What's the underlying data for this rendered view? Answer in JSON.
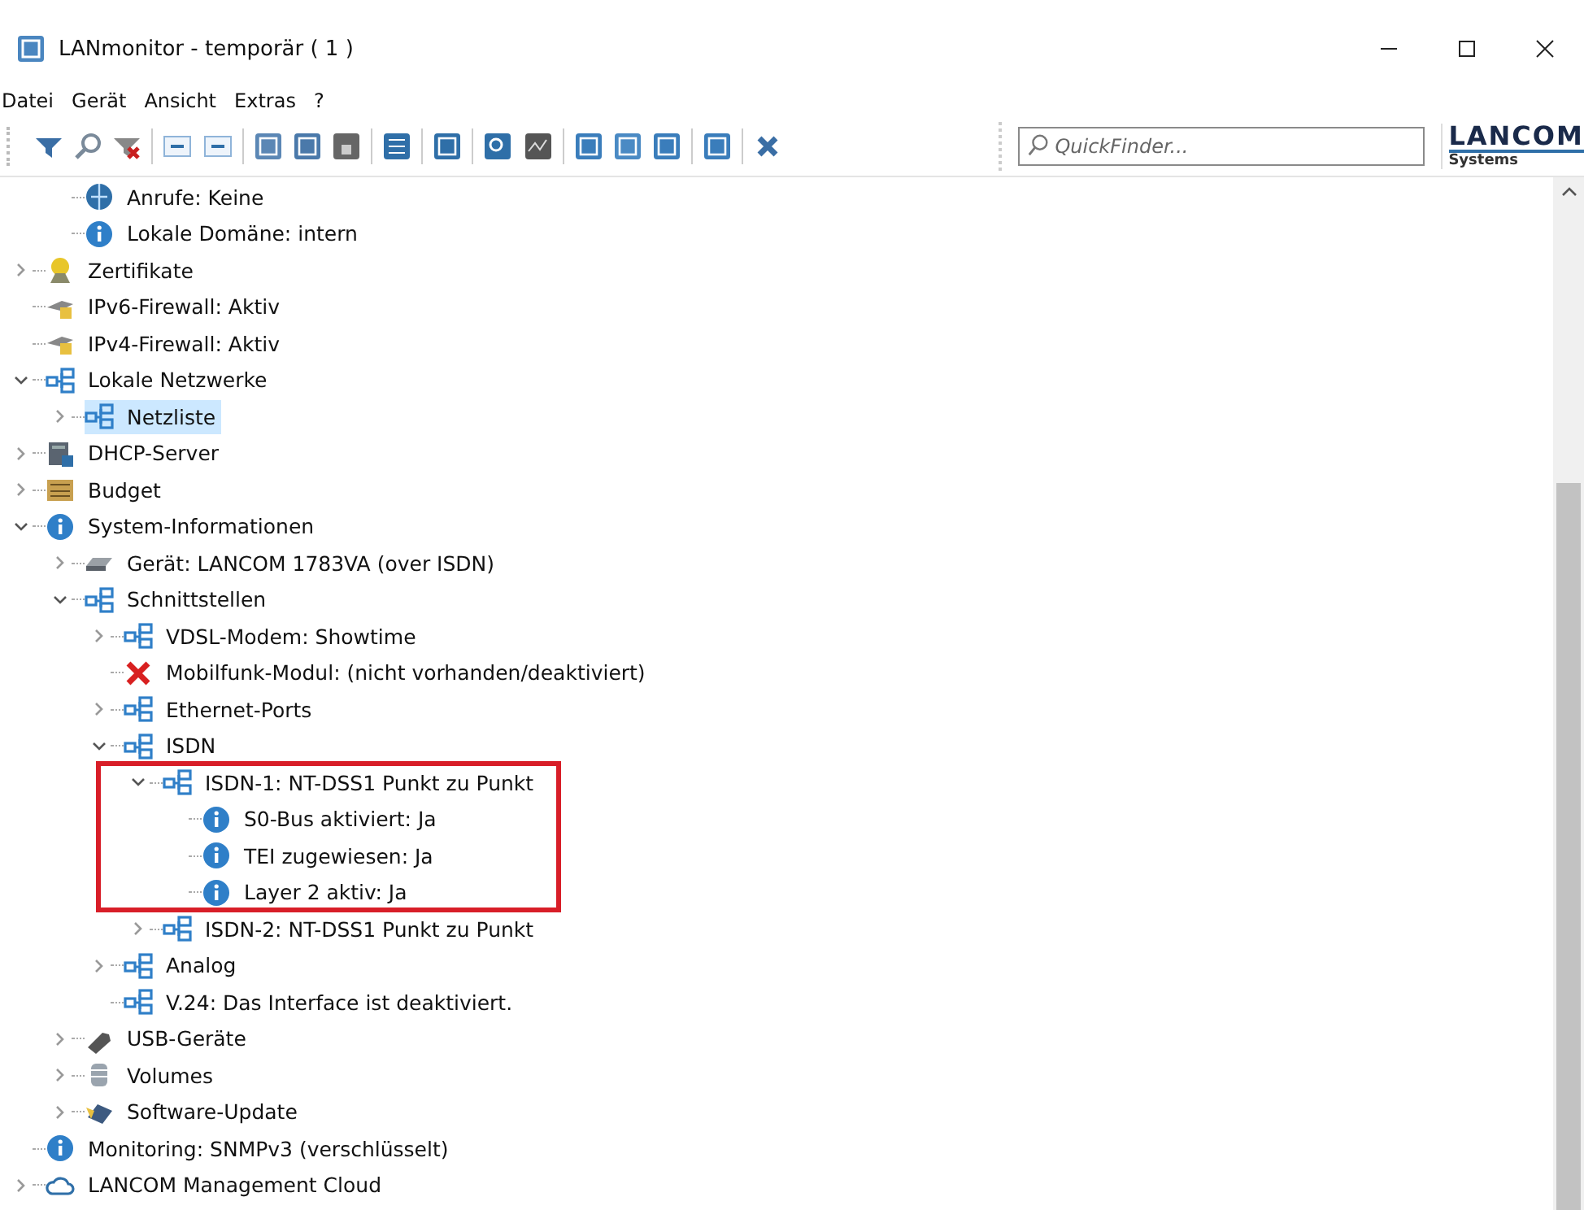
{
  "window": {
    "title": "LANmonitor - temporär ( 1 )"
  },
  "menu": [
    "Datei",
    "Gerät",
    "Ansicht",
    "Extras",
    "?"
  ],
  "quickfinder": {
    "placeholder": "QuickFinder..."
  },
  "logo": {
    "name": "LANCOM",
    "subtitle": "Systems"
  },
  "tree": {
    "continued_items": [
      {
        "label": "Anrufe: Keine",
        "kind": "globe",
        "selected": false
      },
      {
        "label": "Lokale Domäne: intern",
        "kind": "info",
        "selected": false
      }
    ],
    "items": [
      {
        "label": "Zertifikate",
        "kind": "certificate",
        "expanded": false,
        "selected": false
      },
      {
        "label": "IPv6-Firewall: Aktiv",
        "kind": "firewall",
        "selected": false
      },
      {
        "label": "IPv4-Firewall: Aktiv",
        "kind": "firewall",
        "selected": false
      },
      {
        "label": "Lokale Netzwerke",
        "kind": "network",
        "expanded": true,
        "selected": false,
        "children": [
          {
            "label": "Netzliste",
            "kind": "network",
            "expanded": false,
            "selected": true
          }
        ]
      },
      {
        "label": "DHCP-Server",
        "kind": "server",
        "expanded": false,
        "selected": false
      },
      {
        "label": "Budget",
        "kind": "budget",
        "expanded": false,
        "selected": false
      },
      {
        "label": "System-Informationen",
        "kind": "info",
        "expanded": true,
        "selected": false,
        "children": [
          {
            "label": "Gerät: LANCOM 1783VA (over ISDN)",
            "kind": "device",
            "expanded": false,
            "selected": false
          },
          {
            "label": "Schnittstellen",
            "kind": "network",
            "expanded": true,
            "selected": false,
            "children": [
              {
                "label": "VDSL-Modem: Showtime",
                "kind": "network",
                "expanded": false,
                "selected": false
              },
              {
                "label": "Mobilfunk-Modul: (nicht vorhanden/deaktiviert)",
                "kind": "error",
                "selected": false
              },
              {
                "label": "Ethernet-Ports",
                "kind": "network",
                "expanded": false,
                "selected": false
              },
              {
                "label": "ISDN",
                "kind": "network",
                "expanded": true,
                "selected": false,
                "children": [
                  {
                    "label": "ISDN-1: NT-DSS1 Punkt zu Punkt",
                    "kind": "network",
                    "expanded": true,
                    "selected": false,
                    "highlighted": true,
                    "children": [
                      {
                        "label": "S0-Bus aktiviert: Ja",
                        "kind": "info",
                        "selected": false
                      },
                      {
                        "label": "TEI zugewiesen: Ja",
                        "kind": "info",
                        "selected": false
                      },
                      {
                        "label": "Layer 2 aktiv: Ja",
                        "kind": "info",
                        "selected": false
                      }
                    ]
                  },
                  {
                    "label": "ISDN-2: NT-DSS1 Punkt zu Punkt",
                    "kind": "network",
                    "expanded": false,
                    "selected": false
                  }
                ]
              },
              {
                "label": "Analog",
                "kind": "network",
                "expanded": false,
                "selected": false
              },
              {
                "label": "V.24: Das Interface ist deaktiviert.",
                "kind": "network",
                "selected": false
              }
            ]
          },
          {
            "label": "USB-Geräte",
            "kind": "usb",
            "expanded": false,
            "selected": false
          },
          {
            "label": "Volumes",
            "kind": "volumes",
            "expanded": false,
            "selected": false
          },
          {
            "label": "Software-Update",
            "kind": "software",
            "expanded": false,
            "selected": false
          }
        ]
      },
      {
        "label": "Monitoring: SNMPv3 (verschlüsselt)",
        "kind": "info",
        "selected": false
      },
      {
        "label": "LANCOM Management Cloud",
        "kind": "cloud",
        "expanded": false,
        "selected": false
      }
    ]
  }
}
